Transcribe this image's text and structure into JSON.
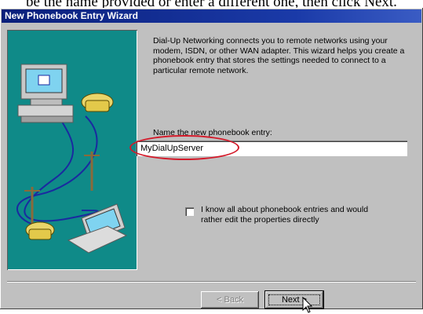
{
  "top_caption": "be the name provided or enter a different one, then click Next.",
  "window": {
    "title": "New Phonebook Entry Wizard"
  },
  "wizard": {
    "description": "Dial-Up Networking connects you to remote networks using your modem, ISDN, or other WAN adapter.  This wizard helps you create a phonebook entry that stores the settings needed to connect to a particular remote network.",
    "name_label": "Name the new phonebook entry:",
    "name_value": "MyDialUpServer",
    "checkbox_label": "I know all about phonebook entries and would rather edit the properties directly",
    "checkbox_checked": false
  },
  "buttons": {
    "back": "< Back",
    "next": "Next >"
  },
  "colors": {
    "title_bar": "#0a1f7a",
    "art_background": "#0f8a88",
    "highlight_ellipse": "#d41a2a"
  }
}
